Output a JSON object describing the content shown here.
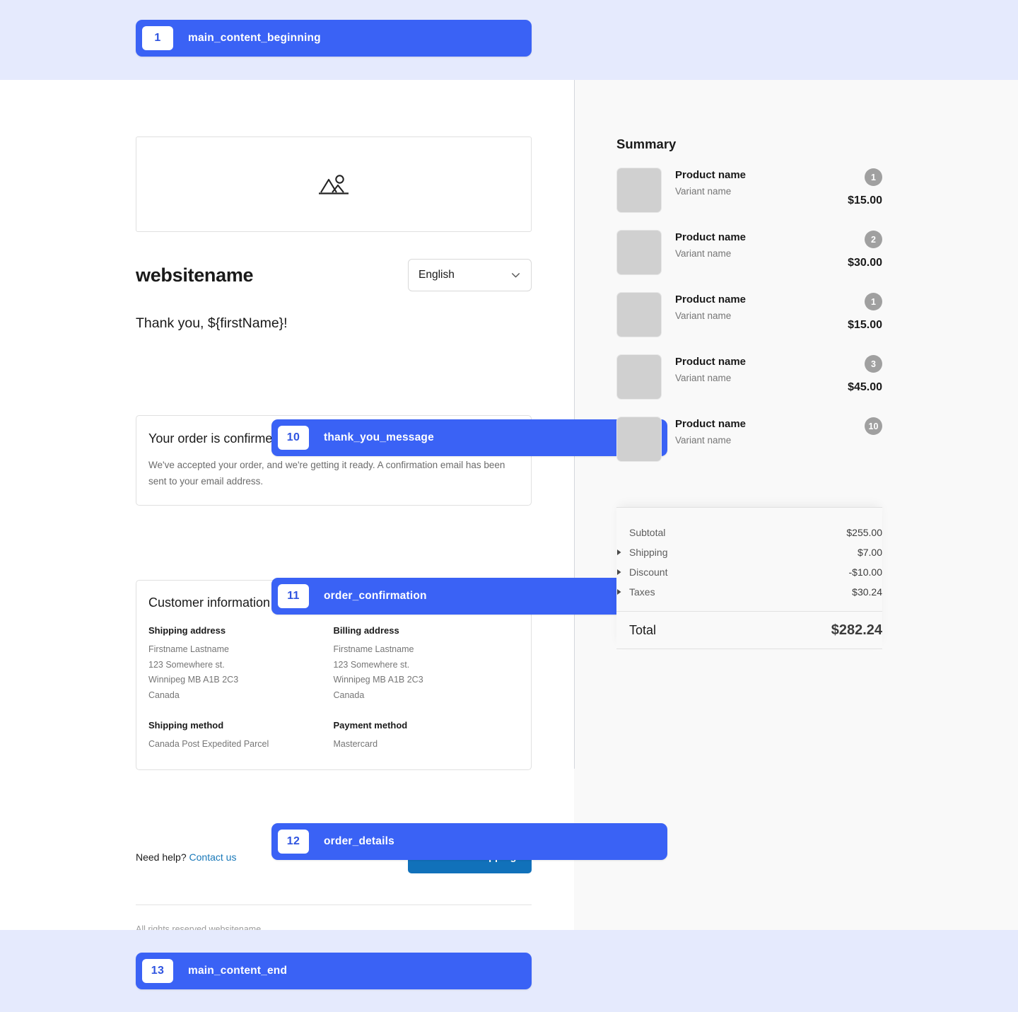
{
  "annotations": [
    {
      "number": "1",
      "label": "main_content_beginning"
    },
    {
      "number": "10",
      "label": "thank_you_message"
    },
    {
      "number": "11",
      "label": "order_confirmation"
    },
    {
      "number": "12",
      "label": "order_details"
    },
    {
      "number": "13",
      "label": "main_content_end"
    }
  ],
  "header": {
    "logo_placeholder_icon": "image-placeholder-icon",
    "brand_name": "websitename",
    "language": {
      "selected": "English",
      "chevron_icon": "chevron-down-icon"
    }
  },
  "thank_you": {
    "message": "Thank you, ${firstName}!"
  },
  "confirmation": {
    "title": "Your order is confirmed",
    "body": "We've accepted your order, and we're getting it ready. A confirmation email has been sent to your email address."
  },
  "customer_information": {
    "title": "Customer information",
    "shipping_address": {
      "heading": "Shipping address",
      "lines": [
        "Firstname Lastname",
        "123 Somewhere st.",
        "Winnipeg MB A1B 2C3",
        "Canada"
      ]
    },
    "billing_address": {
      "heading": "Billing address",
      "lines": [
        "Firstname Lastname",
        "123 Somewhere st.",
        "Winnipeg MB A1B 2C3",
        "Canada"
      ]
    },
    "shipping_method": {
      "heading": "Shipping method",
      "value": "Canada Post Expedited Parcel"
    },
    "payment_method": {
      "heading": "Payment method",
      "value": "Mastercard"
    }
  },
  "footer": {
    "need_help_text": "Need help? ",
    "contact_link": "Contact us",
    "continue_button": "Continue shopping",
    "copyright": "All rights reserved websitename"
  },
  "summary": {
    "title": "Summary",
    "items": [
      {
        "name": "Product name",
        "variant": "Variant name",
        "qty": "1",
        "price": "$15.00"
      },
      {
        "name": "Product name",
        "variant": "Variant name",
        "qty": "2",
        "price": "$30.00"
      },
      {
        "name": "Product name",
        "variant": "Variant name",
        "qty": "1",
        "price": "$15.00"
      },
      {
        "name": "Product name",
        "variant": "Variant name",
        "qty": "3",
        "price": "$45.00"
      },
      {
        "name": "Product name",
        "variant": "Variant name",
        "qty": "10",
        "price": ""
      }
    ],
    "totals": [
      {
        "label": "Subtotal",
        "value": "$255.00",
        "expandable": false
      },
      {
        "label": "Shipping",
        "value": "$7.00",
        "expandable": true
      },
      {
        "label": "Discount",
        "value": "-$10.00",
        "expandable": true
      },
      {
        "label": "Taxes",
        "value": "$30.24",
        "expandable": true
      }
    ],
    "total": {
      "label": "Total",
      "value": "$282.24"
    }
  },
  "colors": {
    "annotation_blue": "#3a62f5",
    "band_blue": "#e5eafd",
    "primary_button": "#1171ba",
    "link_blue": "#1878b9",
    "summary_bg": "#f9f9f9",
    "qty_badge": "#a0a0a0"
  }
}
